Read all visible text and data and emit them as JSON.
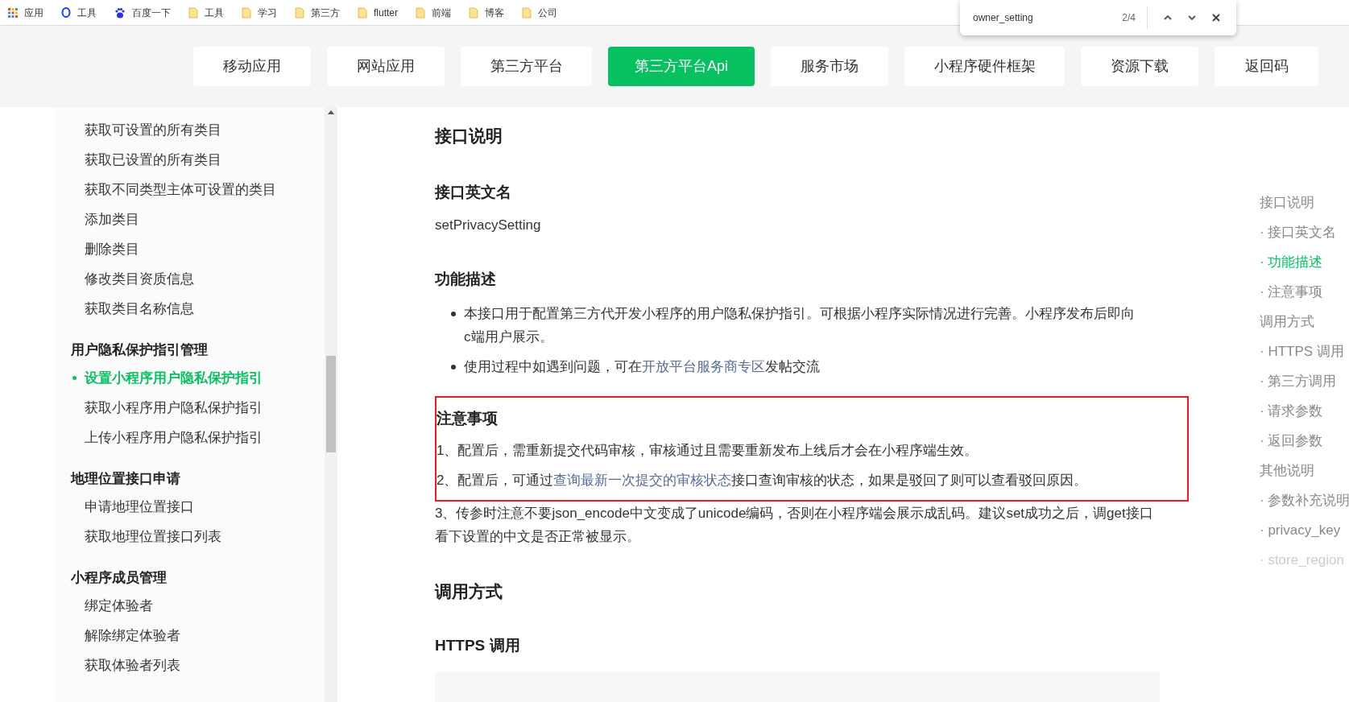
{
  "bookmarks": [
    {
      "kind": "apps",
      "label": "应用"
    },
    {
      "kind": "ring",
      "label": "工具"
    },
    {
      "kind": "paw",
      "label": "百度一下"
    },
    {
      "kind": "folder",
      "label": "工具"
    },
    {
      "kind": "folder",
      "label": "学习"
    },
    {
      "kind": "folder",
      "label": "第三方"
    },
    {
      "kind": "folder",
      "label": "flutter"
    },
    {
      "kind": "folder",
      "label": "前端"
    },
    {
      "kind": "folder",
      "label": "博客"
    },
    {
      "kind": "folder",
      "label": "公司"
    }
  ],
  "find_bar": {
    "value": "owner_setting",
    "count": "2/4"
  },
  "nav_tabs": [
    {
      "label": "移动应用",
      "selected": false
    },
    {
      "label": "网站应用",
      "selected": false
    },
    {
      "label": "第三方平台",
      "selected": false
    },
    {
      "label": "第三方平台Api",
      "selected": true
    },
    {
      "label": "服务市场",
      "selected": false
    },
    {
      "label": "小程序硬件框架",
      "selected": false
    },
    {
      "label": "资源下载",
      "selected": false
    },
    {
      "label": "返回码",
      "selected": false
    }
  ],
  "sidebar": {
    "groups": [
      {
        "items": [
          {
            "label": "获取可设置的所有类目",
            "selected": false
          },
          {
            "label": "获取已设置的所有类目",
            "selected": false
          },
          {
            "label": "获取不同类型主体可设置的类目",
            "selected": false
          },
          {
            "label": "添加类目",
            "selected": false
          },
          {
            "label": "删除类目",
            "selected": false
          },
          {
            "label": "修改类目资质信息",
            "selected": false
          },
          {
            "label": "获取类目名称信息",
            "selected": false
          }
        ]
      },
      {
        "title": "用户隐私保护指引管理",
        "items": [
          {
            "label": "设置小程序用户隐私保护指引",
            "selected": true
          },
          {
            "label": "获取小程序用户隐私保护指引",
            "selected": false
          },
          {
            "label": "上传小程序用户隐私保护指引",
            "selected": false
          }
        ]
      },
      {
        "title": "地理位置接口申请",
        "items": [
          {
            "label": "申请地理位置接口",
            "selected": false
          },
          {
            "label": "获取地理位置接口列表",
            "selected": false
          }
        ]
      },
      {
        "title": "小程序成员管理",
        "items": [
          {
            "label": "绑定体验者",
            "selected": false
          },
          {
            "label": "解除绑定体验者",
            "selected": false
          },
          {
            "label": "获取体验者列表",
            "selected": false
          }
        ]
      }
    ]
  },
  "content": {
    "heading_1": "接口说明",
    "english_name_heading": "接口英文名",
    "english_name": "setPrivacySetting",
    "description_heading": "功能描述",
    "description_bullets": [
      "本接口用于配置第三方代开发小程序的用户隐私保护指引。可根据小程序实际情况进行完善。小程序发布后即向c端用户展示。",
      {
        "before": "使用过程中如遇到问题，可在",
        "link": "开放平台服务商专区",
        "after": "发帖交流"
      }
    ],
    "notes_heading": "注意事项",
    "notes": [
      {
        "text": "1、配置后，需重新提交代码审核，审核通过且需要重新发布上线后才会在小程序端生效。",
        "highlighted": true
      },
      {
        "before": "2、配置后，可通过",
        "link": "查询最新一次提交的审核状态",
        "after": "接口查询审核的状态，如果是驳回了则可以查看驳回原因。",
        "highlighted": true
      },
      {
        "text": "3、传参时注意不要json_encode中文变成了unicode编码，否则在小程序端会展示成乱码。建议set成功之后，调get接口看下设置的中文是否正常被显示。",
        "highlighted": false
      }
    ],
    "call_heading": "调用方式",
    "https_heading": "HTTPS 调用"
  },
  "toc": [
    {
      "label": "接口说明",
      "faded": false,
      "selected": false
    },
    {
      "label": "· 接口英文名",
      "faded": false,
      "selected": false
    },
    {
      "label": "· 功能描述",
      "faded": false,
      "selected": true
    },
    {
      "label": "· 注意事项",
      "faded": false,
      "selected": false
    },
    {
      "label": "调用方式",
      "faded": false,
      "selected": false
    },
    {
      "label": "· HTTPS 调用",
      "faded": false,
      "selected": false
    },
    {
      "label": "· 第三方调用",
      "faded": false,
      "selected": false
    },
    {
      "label": "· 请求参数",
      "faded": false,
      "selected": false
    },
    {
      "label": "· 返回参数",
      "faded": false,
      "selected": false
    },
    {
      "label": "其他说明",
      "faded": false,
      "selected": false
    },
    {
      "label": "· 参数补充说明",
      "faded": false,
      "selected": false
    },
    {
      "label": "· privacy_key",
      "faded": false,
      "selected": false
    },
    {
      "label": "· store_region",
      "faded": true,
      "selected": false
    }
  ]
}
